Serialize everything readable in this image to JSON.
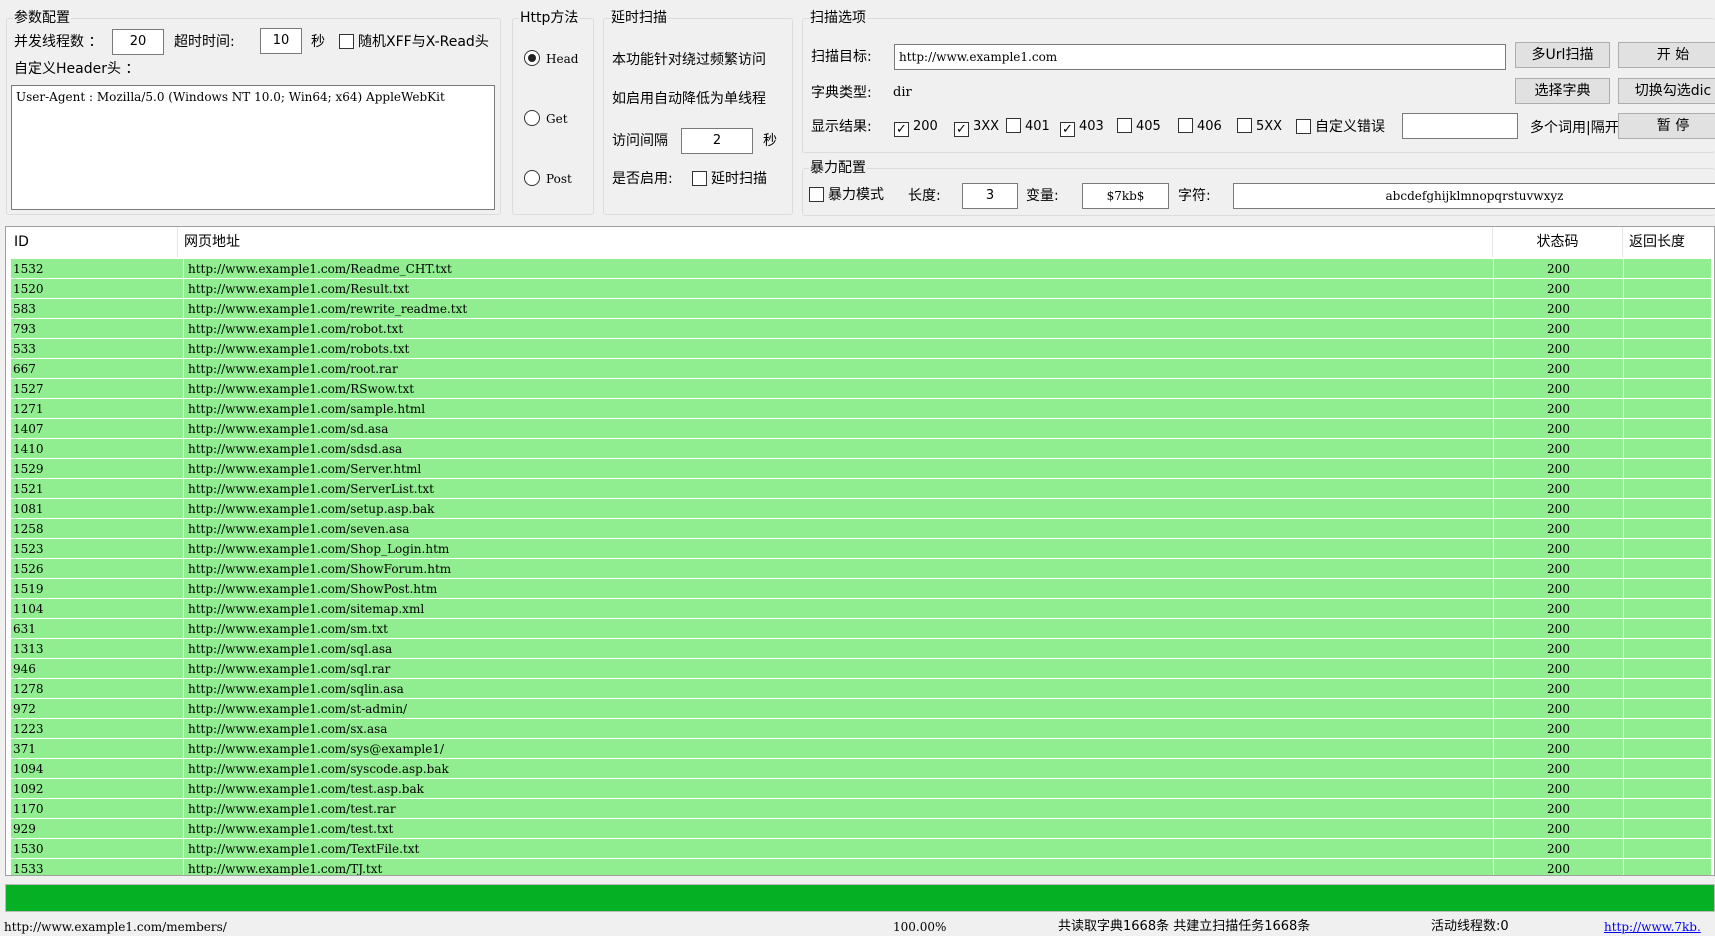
{
  "params": {
    "legend": "参数配置",
    "threads_label": "并发线程数 ：",
    "threads_value": "20",
    "timeout_label": "超时时间:",
    "timeout_value": "10",
    "timeout_unit": "秒",
    "random_xff_label": "随机XFF与X-Read头",
    "random_xff_checked": false,
    "header_label": "自定义Header头 ：",
    "header_value": "User-Agent : Mozilla/5.0 (Windows NT 10.0; Win64; x64) AppleWebKit"
  },
  "http_method": {
    "legend": "Http方法",
    "options": [
      "Head",
      "Get",
      "Post"
    ],
    "selected": "Head"
  },
  "delay_scan": {
    "legend": "延时扫描",
    "desc1": "本功能针对绕过频繁访问",
    "desc2": "如启用自动降低为单线程",
    "interval_label": "访问间隔",
    "interval_value": "2",
    "interval_unit": "秒",
    "enable_label": "是否启用:",
    "enable_checkbox_label": "延时扫描",
    "enable_checked": false
  },
  "scan_options": {
    "legend": "扫描选项",
    "target_label": "扫描目标:",
    "target_value": "http://www.example1.com",
    "multi_url_button": "多Url扫描",
    "start_button": "开 始",
    "dict_type_label": "字典类型:",
    "dict_type_value": "dir",
    "choose_dict_button": "选择字典",
    "switch_dict_button": "切换勾选dic",
    "results_label": "显示结果:",
    "filters": [
      {
        "label": "200",
        "checked": true
      },
      {
        "label": "3XX",
        "checked": true
      },
      {
        "label": "401",
        "checked": false
      },
      {
        "label": "403",
        "checked": true
      },
      {
        "label": "405",
        "checked": false
      },
      {
        "label": "406",
        "checked": false
      },
      {
        "label": "5XX",
        "checked": false
      },
      {
        "label": "自定义错误",
        "checked": false
      }
    ],
    "custom_error_value": "",
    "multi_word_hint": "多个词用|隔开",
    "pause_button": "暂 停"
  },
  "brute": {
    "legend": "暴力配置",
    "mode_label": "暴力模式",
    "mode_checked": false,
    "length_label": "长度:",
    "length_value": "3",
    "variable_label": "变量:",
    "variable_value": "$7kb$",
    "charset_label": "字符:",
    "charset_value": "abcdefghijklmnopqrstuvwxyz"
  },
  "table": {
    "columns": [
      "ID",
      "网页地址",
      "状态码",
      "返回长度"
    ],
    "rows": [
      {
        "id": "1532",
        "url": "http://www.example1.com/Readme_CHT.txt",
        "status": "200",
        "length": ""
      },
      {
        "id": "1520",
        "url": "http://www.example1.com/Result.txt",
        "status": "200",
        "length": ""
      },
      {
        "id": "583",
        "url": "http://www.example1.com/rewrite_readme.txt",
        "status": "200",
        "length": ""
      },
      {
        "id": "793",
        "url": "http://www.example1.com/robot.txt",
        "status": "200",
        "length": ""
      },
      {
        "id": "533",
        "url": "http://www.example1.com/robots.txt",
        "status": "200",
        "length": ""
      },
      {
        "id": "667",
        "url": "http://www.example1.com/root.rar",
        "status": "200",
        "length": ""
      },
      {
        "id": "1527",
        "url": "http://www.example1.com/RSwow.txt",
        "status": "200",
        "length": ""
      },
      {
        "id": "1271",
        "url": "http://www.example1.com/sample.html",
        "status": "200",
        "length": ""
      },
      {
        "id": "1407",
        "url": "http://www.example1.com/sd.asa",
        "status": "200",
        "length": ""
      },
      {
        "id": "1410",
        "url": "http://www.example1.com/sdsd.asa",
        "status": "200",
        "length": ""
      },
      {
        "id": "1529",
        "url": "http://www.example1.com/Server.html",
        "status": "200",
        "length": ""
      },
      {
        "id": "1521",
        "url": "http://www.example1.com/ServerList.txt",
        "status": "200",
        "length": ""
      },
      {
        "id": "1081",
        "url": "http://www.example1.com/setup.asp.bak",
        "status": "200",
        "length": ""
      },
      {
        "id": "1258",
        "url": "http://www.example1.com/seven.asa",
        "status": "200",
        "length": ""
      },
      {
        "id": "1523",
        "url": "http://www.example1.com/Shop_Login.htm",
        "status": "200",
        "length": ""
      },
      {
        "id": "1526",
        "url": "http://www.example1.com/ShowForum.htm",
        "status": "200",
        "length": ""
      },
      {
        "id": "1519",
        "url": "http://www.example1.com/ShowPost.htm",
        "status": "200",
        "length": ""
      },
      {
        "id": "1104",
        "url": "http://www.example1.com/sitemap.xml",
        "status": "200",
        "length": ""
      },
      {
        "id": "631",
        "url": "http://www.example1.com/sm.txt",
        "status": "200",
        "length": ""
      },
      {
        "id": "1313",
        "url": "http://www.example1.com/sql.asa",
        "status": "200",
        "length": ""
      },
      {
        "id": "946",
        "url": "http://www.example1.com/sql.rar",
        "status": "200",
        "length": ""
      },
      {
        "id": "1278",
        "url": "http://www.example1.com/sqlin.asa",
        "status": "200",
        "length": ""
      },
      {
        "id": "972",
        "url": "http://www.example1.com/st-admin/",
        "status": "200",
        "length": ""
      },
      {
        "id": "1223",
        "url": "http://www.example1.com/sx.asa",
        "status": "200",
        "length": ""
      },
      {
        "id": "371",
        "url": "http://www.example1.com/sys@example1/",
        "status": "200",
        "length": ""
      },
      {
        "id": "1094",
        "url": "http://www.example1.com/syscode.asp.bak",
        "status": "200",
        "length": ""
      },
      {
        "id": "1092",
        "url": "http://www.example1.com/test.asp.bak",
        "status": "200",
        "length": ""
      },
      {
        "id": "1170",
        "url": "http://www.example1.com/test.rar",
        "status": "200",
        "length": ""
      },
      {
        "id": "929",
        "url": "http://www.example1.com/test.txt",
        "status": "200",
        "length": ""
      },
      {
        "id": "1530",
        "url": "http://www.example1.com/TextFile.txt",
        "status": "200",
        "length": ""
      },
      {
        "id": "1533",
        "url": "http://www.example1.com/TJ.txt",
        "status": "200",
        "length": ""
      }
    ]
  },
  "progress": {
    "fraction": 1.0
  },
  "statusbar": {
    "current_url": "http://www.example1.com/members/",
    "percent": "100.00%",
    "summary": "共读取字典1668条  共建立扫描任务1668条",
    "active_threads": "活动线程数:0",
    "link": "http://www.7kb."
  },
  "colors": {
    "row_bg": "#90ee90",
    "progress": "#06b025",
    "link": "#0000ee"
  }
}
